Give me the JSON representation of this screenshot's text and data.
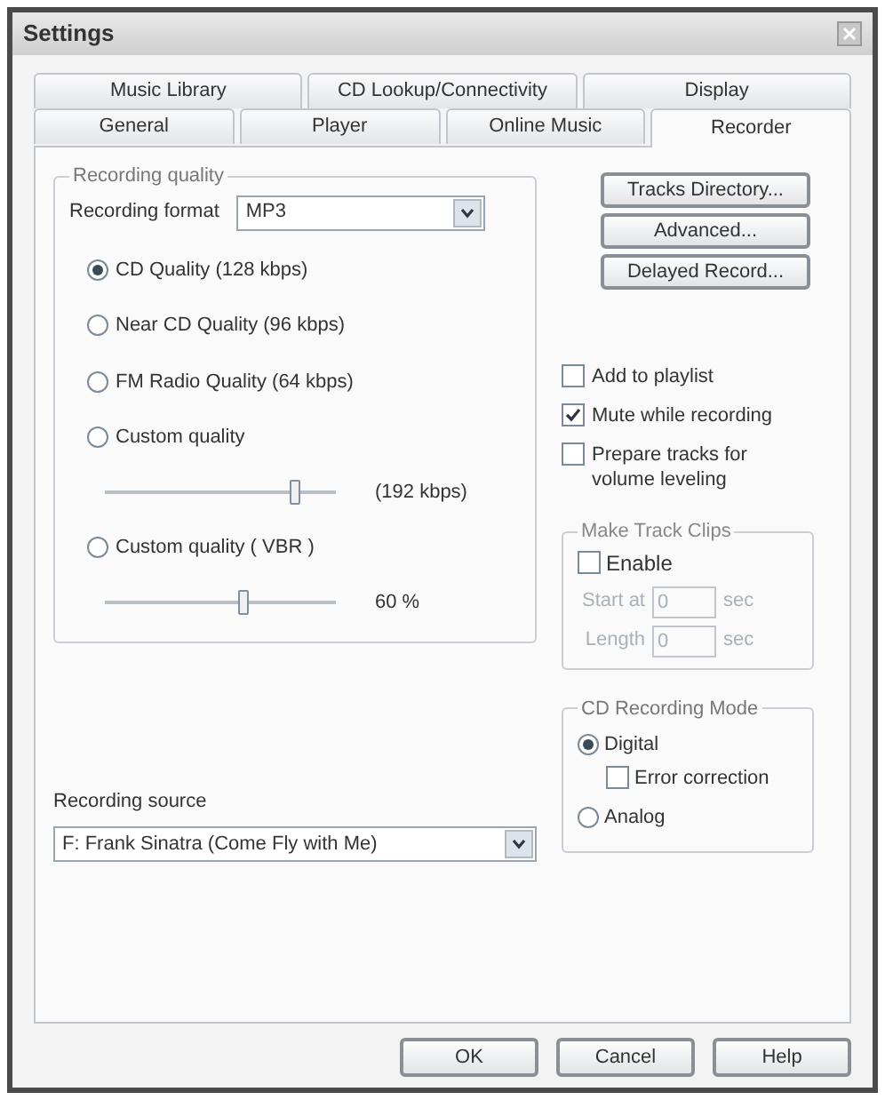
{
  "window": {
    "title": "Settings"
  },
  "tabs": [
    [
      {
        "label": "Music Library",
        "selected": false
      },
      {
        "label": "CD Lookup/Connectivity",
        "selected": false
      },
      {
        "label": "Display",
        "selected": false
      }
    ],
    [
      {
        "label": "General",
        "selected": false
      },
      {
        "label": "Player",
        "selected": false
      },
      {
        "label": "Online Music",
        "selected": false
      },
      {
        "label": "Recorder",
        "selected": true
      }
    ]
  ],
  "recording_quality": {
    "title": "Recording quality",
    "format_label": "Recording format",
    "format_value": "MP3",
    "options": [
      {
        "label": "CD Quality (128 kbps)",
        "selected": true
      },
      {
        "label": "Near CD Quality (96 kbps)",
        "selected": false
      },
      {
        "label": "FM Radio Quality (64 kbps)",
        "selected": false
      },
      {
        "label": "Custom quality",
        "selected": false,
        "slider": {
          "level": 0.82,
          "reading": "(192 kbps)"
        }
      },
      {
        "label": "Custom quality ( VBR )",
        "selected": false,
        "slider": {
          "level": 0.6,
          "reading": "60 %"
        }
      }
    ]
  },
  "side_buttons": [
    "Tracks Directory...",
    "Advanced...",
    "Delayed Record..."
  ],
  "checkboxes": [
    {
      "label": "Add to playlist",
      "checked": false
    },
    {
      "label": "Mute while recording",
      "checked": true
    },
    {
      "label": "Prepare tracks for volume leveling",
      "checked": false
    }
  ],
  "track_clips": {
    "title": "Make Track Clips",
    "enable": {
      "label": "Enable",
      "checked": false
    },
    "disabled": true,
    "fields": [
      {
        "label": "Start at",
        "value": "0",
        "unit": "sec"
      },
      {
        "label": "Length",
        "value": "0",
        "unit": "sec"
      }
    ]
  },
  "cd_recording_mode": {
    "title": "CD Recording Mode",
    "options": [
      {
        "label": "Digital",
        "selected": true,
        "sub_checkbox": {
          "label": "Error correction",
          "checked": false
        }
      },
      {
        "label": "Analog",
        "selected": false
      }
    ]
  },
  "recording_source": {
    "label": "Recording source",
    "value": "F: Frank Sinatra (Come Fly with Me)"
  },
  "footer_buttons": [
    "OK",
    "Cancel",
    "Help"
  ]
}
